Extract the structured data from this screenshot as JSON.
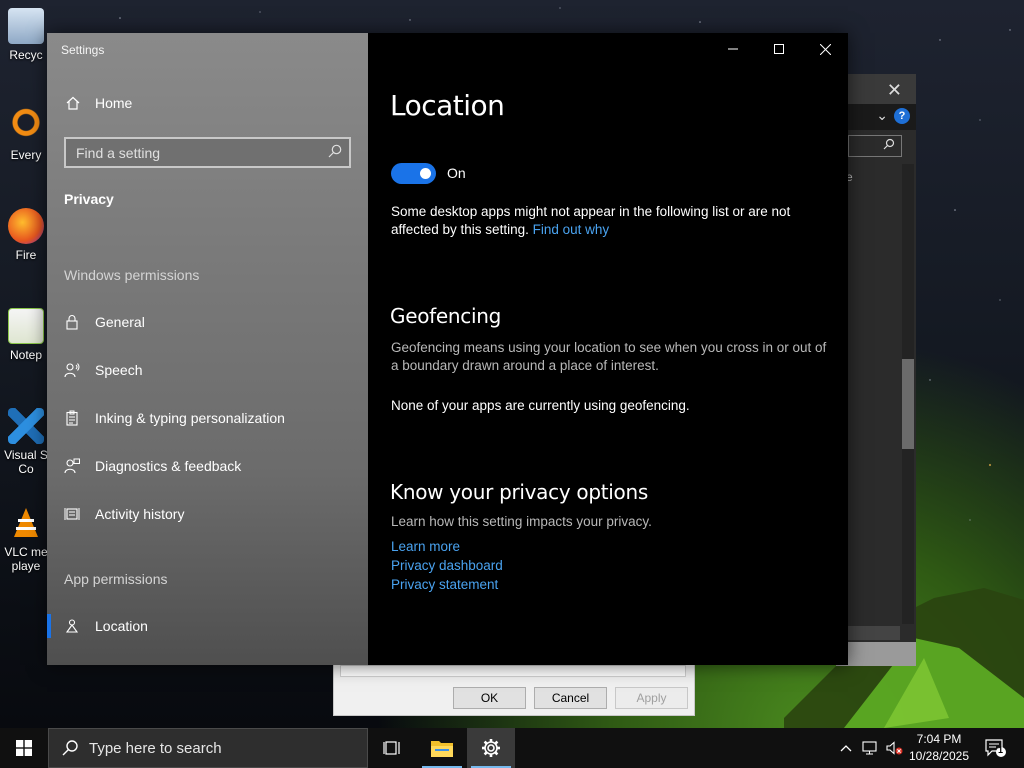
{
  "desktop": {
    "icons": [
      {
        "label": "Recyc",
        "color": "#9ab8d6"
      },
      {
        "label": "Every",
        "color": "#f28c13"
      },
      {
        "label": "Fire",
        "color": "#e8561f"
      },
      {
        "label": "Notep",
        "color": "#8cc84b"
      },
      {
        "label": "Visual S\nCo",
        "color": "#2d8fe0"
      },
      {
        "label": "VLC me\nplaye",
        "color": "#f08a00"
      }
    ]
  },
  "background_dialog": {
    "ok_label": "OK",
    "cancel_label": "Cancel",
    "apply_label": "Apply"
  },
  "background_window": {
    "close_glyph": "✕",
    "help_glyph": "?",
    "chevron_glyph": "⌄",
    "side_text": "e"
  },
  "settings": {
    "window_title": "Settings",
    "sidebar": {
      "home_label": "Home",
      "search_placeholder": "Find a setting",
      "current_category": "Privacy",
      "windows_permissions_label": "Windows permissions",
      "windows_permissions_items": [
        {
          "label": "General",
          "icon": "lock-icon"
        },
        {
          "label": "Speech",
          "icon": "speech-icon"
        },
        {
          "label": "Inking & typing personalization",
          "icon": "clipboard-icon"
        },
        {
          "label": "Diagnostics & feedback",
          "icon": "feedback-icon"
        },
        {
          "label": "Activity history",
          "icon": "timeline-icon"
        }
      ],
      "app_permissions_label": "App permissions",
      "app_permissions_items": [
        {
          "label": "Location",
          "icon": "location-icon",
          "active": true
        }
      ]
    },
    "content": {
      "page_title": "Location",
      "toggle_label": "On",
      "toggle_on": true,
      "desktop_apps_note": "Some desktop apps might not appear in the following list or are not affected by this setting.",
      "find_out_why_link": "Find out why",
      "geofencing_heading": "Geofencing",
      "geofencing_description": "Geofencing means using your location to see when you cross in or out of a boundary drawn around a place of interest.",
      "geofencing_status": "None of your apps are currently using geofencing.",
      "privacy_options_heading": "Know your privacy options",
      "privacy_options_description": "Learn how this setting impacts your privacy.",
      "links": [
        "Learn more",
        "Privacy dashboard",
        "Privacy statement"
      ]
    },
    "accent_color": "#1a73e8",
    "link_color": "#4aa3f0"
  },
  "taskbar": {
    "search_placeholder": "Type here to search",
    "apps": [
      {
        "name": "task-view-icon"
      },
      {
        "name": "file-explorer-icon"
      },
      {
        "name": "settings-gear-icon"
      }
    ],
    "clock_time": "7:04 PM",
    "clock_date": "10/28/2025",
    "notification_count": "1"
  }
}
